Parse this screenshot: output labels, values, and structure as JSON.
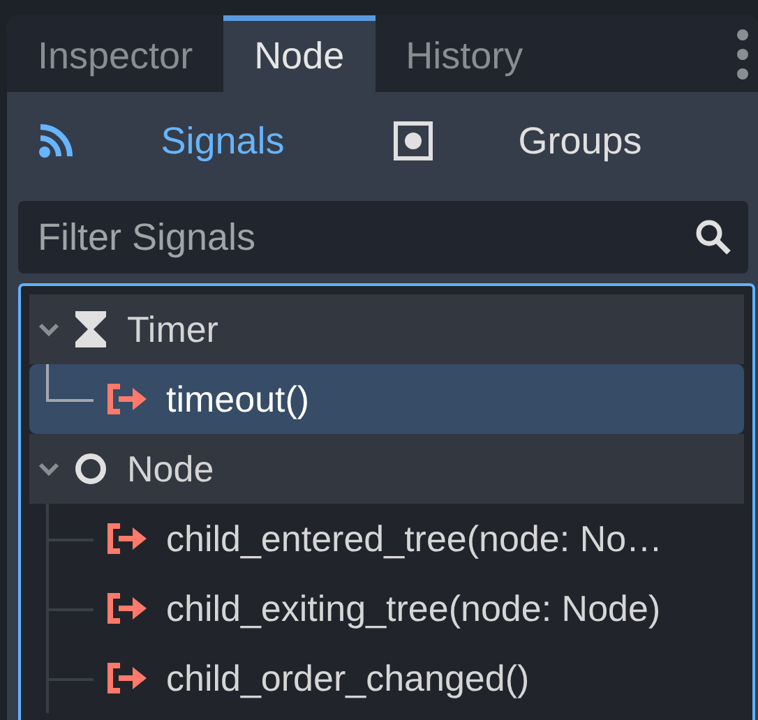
{
  "tabs": [
    {
      "label": "Inspector",
      "selected": false
    },
    {
      "label": "Node",
      "selected": true
    },
    {
      "label": "History",
      "selected": false
    }
  ],
  "subtabs": [
    {
      "label": "Signals",
      "selected": true
    },
    {
      "label": "Groups",
      "selected": false
    }
  ],
  "filter": {
    "placeholder": "Filter Signals"
  },
  "tree": [
    {
      "label": "Timer",
      "expanded": true,
      "children": [
        {
          "label": "timeout()",
          "selected": true
        }
      ]
    },
    {
      "label": "Node",
      "expanded": true,
      "children": [
        {
          "label": "child_entered_tree(node: No…",
          "selected": false
        },
        {
          "label": "child_exiting_tree(node: Node)",
          "selected": false
        },
        {
          "label": "child_order_changed()",
          "selected": false
        }
      ]
    }
  ]
}
